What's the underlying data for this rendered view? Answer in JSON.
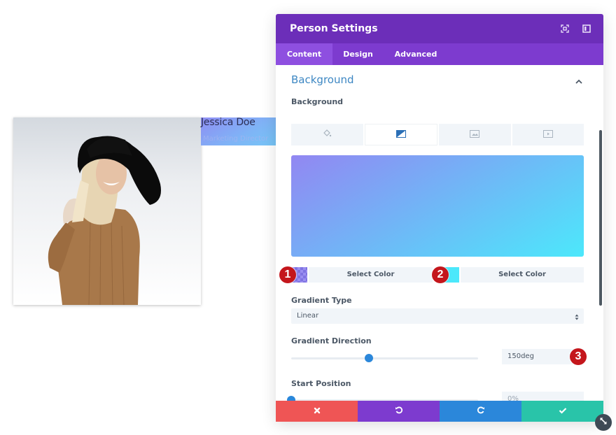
{
  "preview": {
    "person_name": "Jessica Doe",
    "person_position": "Marketing Director",
    "photo_alt": "Smiling woman in black hat and brown sweater"
  },
  "modal": {
    "title": "Person Settings",
    "header_icons": [
      "fullscreen-icon",
      "split-view-icon"
    ],
    "tabs": [
      {
        "label": "Content",
        "active": true
      },
      {
        "label": "Design",
        "active": false
      },
      {
        "label": "Advanced",
        "active": false
      }
    ],
    "section": {
      "title": "Background",
      "expanded": true
    },
    "background": {
      "label": "Background",
      "types": [
        {
          "icon": "paint-bucket-icon",
          "name": "color",
          "active": false
        },
        {
          "icon": "gradient-icon",
          "name": "gradient",
          "active": true
        },
        {
          "icon": "image-icon",
          "name": "image",
          "active": false
        },
        {
          "icon": "video-icon",
          "name": "video",
          "active": false
        }
      ],
      "gradient_start_color": "#9287f2",
      "gradient_end_color": "#4ce8fb",
      "color_stops": [
        {
          "badge": "1",
          "button_label": "Select Color",
          "swatch_color": "#8c80ea"
        },
        {
          "badge": "2",
          "button_label": "Select Color",
          "swatch_color": "#4ce8fb"
        }
      ]
    },
    "gradient_type": {
      "label": "Gradient Type",
      "value": "Linear"
    },
    "gradient_direction": {
      "label": "Gradient Direction",
      "value": "150deg",
      "slider_fraction": 0.4167,
      "badge": "3"
    },
    "start_position": {
      "label": "Start Position",
      "placeholder": "0%",
      "slider_fraction": 0
    },
    "footer": {
      "buttons": [
        {
          "name": "cancel",
          "icon": "close-icon",
          "color": "#ef5555"
        },
        {
          "name": "undo",
          "icon": "undo-icon",
          "color": "#7d3bcf"
        },
        {
          "name": "redo",
          "icon": "redo-icon",
          "color": "#2b87da"
        },
        {
          "name": "save",
          "icon": "check-icon",
          "color": "#29c4a9"
        }
      ]
    }
  },
  "colors": {
    "header": "#6c2eb9",
    "tabs_bar": "#7d3bcf",
    "active_tab": "#8e4fe0",
    "accent_blue": "#2b87da",
    "section_title": "#3d87c3",
    "badge_red": "#c4161c"
  }
}
